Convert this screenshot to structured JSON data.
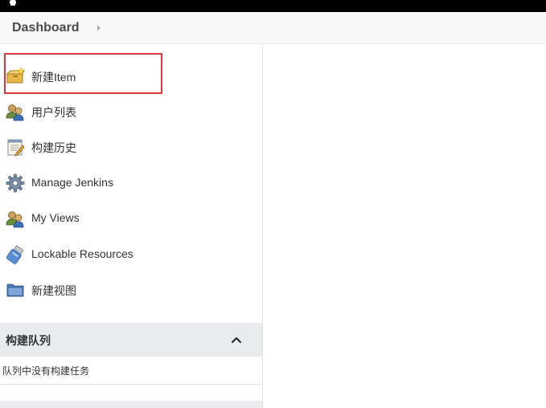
{
  "breadcrumb": {
    "items": [
      {
        "label": "Dashboard"
      }
    ]
  },
  "sidebar": {
    "tasks": [
      {
        "label": "新建Item",
        "icon": "new-package-icon",
        "highlighted": true
      },
      {
        "label": "用户列表",
        "icon": "user-group-icon"
      },
      {
        "label": "构建历史",
        "icon": "notepad-icon"
      },
      {
        "label": "Manage Jenkins",
        "icon": "gear-icon"
      },
      {
        "label": "My Views",
        "icon": "user-group-icon"
      },
      {
        "label": "Lockable Resources",
        "icon": "usb-drive-icon"
      },
      {
        "label": "新建视图",
        "icon": "folder-icon"
      }
    ]
  },
  "build_queue": {
    "title": "构建队列",
    "empty_text": "队列中没有构建任务",
    "collapse_icon": "chevron-up-icon"
  },
  "colors": {
    "highlight_border": "#d9363e",
    "topbar": "#000000",
    "pane_header": "#e9ebee"
  }
}
